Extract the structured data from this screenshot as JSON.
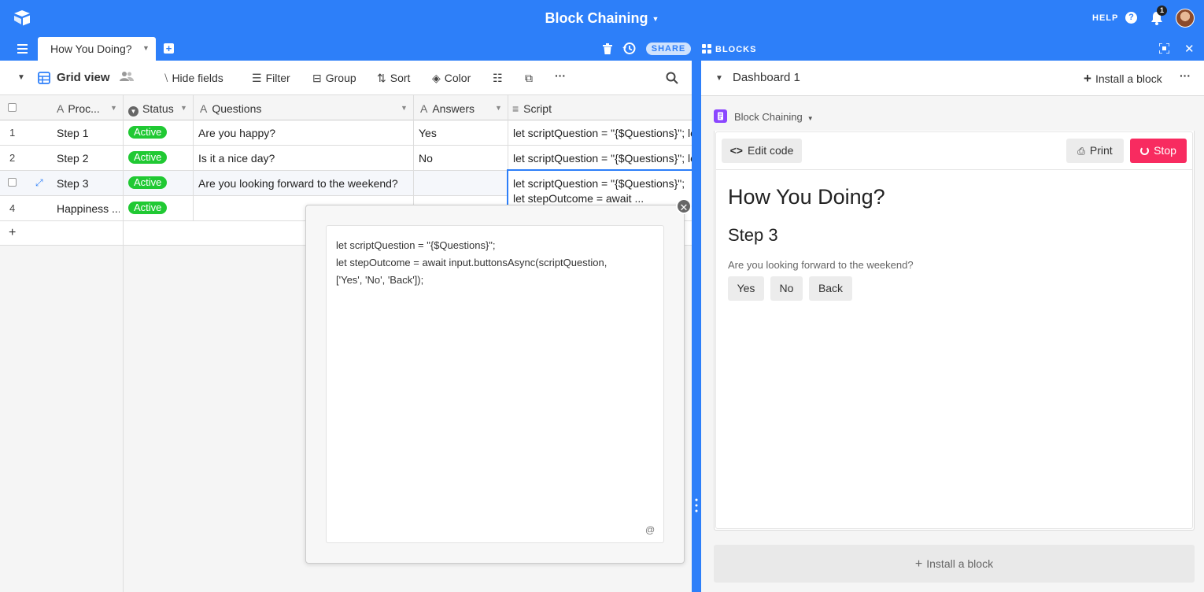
{
  "app": {
    "base_title": "Block Chaining"
  },
  "topbar": {
    "help": "HELP",
    "notification_count": "1"
  },
  "tabs": {
    "active": "How You Doing?"
  },
  "actions": {
    "share": "SHARE",
    "blocks": "BLOCKS"
  },
  "toolbar": {
    "view_name": "Grid view",
    "hide_fields": "Hide fields",
    "filter": "Filter",
    "group": "Group",
    "sort": "Sort",
    "color": "Color",
    "more": "···"
  },
  "columns": [
    "Proc...",
    "Status",
    "Questions",
    "Answers",
    "Script"
  ],
  "rows": [
    {
      "num": "1",
      "proc": "Step 1",
      "status": "Active",
      "question": "Are you happy?",
      "answer": "Yes",
      "script": "let scriptQuestion = \"{$Questions}\"; le"
    },
    {
      "num": "2",
      "proc": "Step 2",
      "status": "Active",
      "question": "Is it a nice day?",
      "answer": "No",
      "script": "let scriptQuestion = \"{$Questions}\"; le"
    },
    {
      "num": "",
      "proc": "Step 3",
      "status": "Active",
      "question": "Are you looking forward to the weekend?",
      "answer": "",
      "script": "let scriptQuestion = \"{$Questions}\";",
      "script_line2": "let stepOutcome = await ..."
    },
    {
      "num": "4",
      "proc": "Happiness ...",
      "status": "Active",
      "question": "",
      "answer": "",
      "script": ""
    }
  ],
  "add_row": "+",
  "editor": {
    "content": "let scriptQuestion = \"{$Questions}\";\nlet stepOutcome = await input.buttonsAsync(scriptQuestion,\n['Yes', 'No', 'Back']);",
    "at_symbol": "@"
  },
  "dashboard": {
    "name": "Dashboard 1",
    "install_block": "Install a block",
    "block_name": "Block Chaining",
    "edit_code": "Edit code",
    "print": "Print",
    "stop": "Stop",
    "output_title": "How You Doing?",
    "output_step": "Step 3",
    "output_question": "Are you looking forward to the weekend?",
    "output_buttons": [
      "Yes",
      "No",
      "Back"
    ],
    "install_bottom": "Install a block"
  },
  "colors": {
    "brand_blue": "#2d7ff9",
    "active_green": "#20c933",
    "stop_pink": "#f82b60"
  }
}
